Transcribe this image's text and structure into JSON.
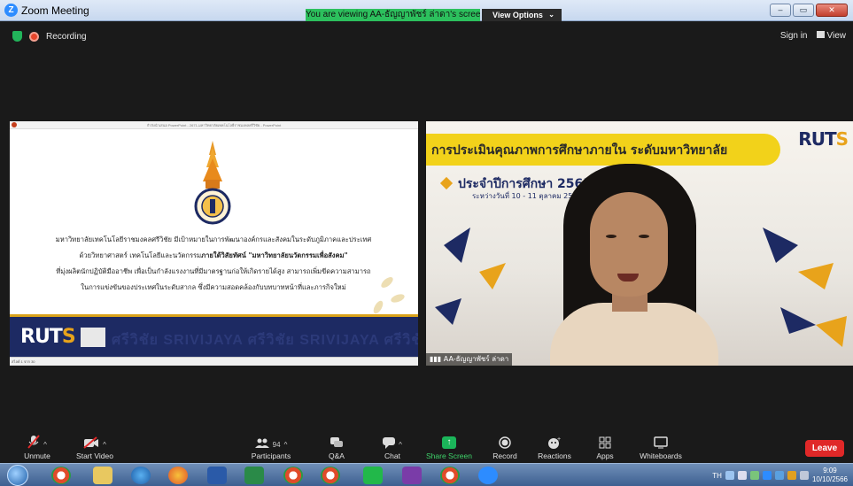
{
  "window": {
    "title": "Zoom Meeting",
    "share_banner": "You are viewing AA-ธัญญาพัชร์ ล่าดา's screen",
    "view_options": "View Options"
  },
  "meeting": {
    "recording_label": "Recording",
    "sign_in": "Sign in",
    "view": "View"
  },
  "slide": {
    "window_title": "กำลังนำเสนอ PowerPoint - 2671-มหาวิทยาลัยเทคโนโลยีราชมงคลศรีวิชัย - PowerPoint",
    "line1": "มหาวิทยาลัยเทคโนโลยีราชมงคลศรีวิชัย มีเป้าหมายในการพัฒนาองค์กรและสังคมในระดับภูมิภาคและประเทศ",
    "line2a": "ด้วยวิทยาศาสตร์ เทคโนโลยีและนวัตกรรม",
    "line2b": "ภายใต้วิสัยทัศน์  \"มหาวิทยาลัยนวัตกรรมเพื่อสังคม\"",
    "line3": "ที่มุ่งผลิตนักปฏิบัติมืออาชีพ เพื่อเป็นกำลังแรงงานที่มีมาตรฐานก่อให้เกิดรายได้สูง สามารถเพิ่มขีดความสามารถ",
    "line4": "ในการแข่งขันของประเทศในระดับสากล ซึ่งมีความสอดคล้องกับบทบาทหน้าที่และภารกิจใหม่",
    "logo_main": "RUT",
    "logo_s": "S",
    "watermark": "ศรีวิชัย SRIVIJAYA ศรีวิชัย SRIVIJAYA ศรีวิชัย SRIVIJAYA ศรีวิชัย",
    "status": "สไลด์ 1 จาก 30"
  },
  "camera": {
    "banner": "การประเมินคุณภาพการศึกษาภายใน ระดับมหาวิทยาลัย",
    "logo_main": "RUT",
    "logo_s": "S",
    "year": "ประจำปีการศึกษา 2565",
    "date": "ระหว่างวันที่ 10 - 11 ตุลาคม 2566",
    "name": "AA-ธัญญาพัชร์ ล่าดา"
  },
  "toolbar": {
    "unmute": "Unmute",
    "start_video": "Start Video",
    "participants": "Participants",
    "participant_count": "94",
    "qa": "Q&A",
    "chat": "Chat",
    "share_screen": "Share Screen",
    "record": "Record",
    "reactions": "Reactions",
    "apps": "Apps",
    "whiteboards": "Whiteboards",
    "leave": "Leave"
  },
  "taskbar": {
    "lang": "TH",
    "time": "9:09",
    "date": "10/10/2566"
  },
  "colors": {
    "zoom_blue": "#2d8cff",
    "share_green": "#2cc05d",
    "leave_red": "#e02828",
    "slide_navy": "#1d2a63",
    "accent_gold": "#e8a31b",
    "banner_yellow": "#f2d21a"
  }
}
